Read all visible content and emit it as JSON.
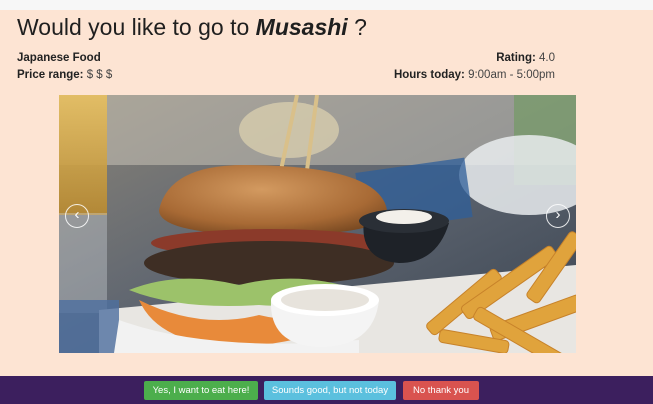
{
  "restaurant": {
    "question_prefix": "Would you like to go to",
    "name": "Musashi",
    "question_suffix": "?",
    "cuisine": "Japanese Food",
    "price_label": "Price range:",
    "price_value": "$ $ $",
    "rating_label": "Rating:",
    "rating_value": "4.0",
    "hours_label": "Hours today:",
    "hours_value": "9:00am - 5:00pm"
  },
  "carousel": {
    "prev_icon": "chevron-left-icon",
    "next_icon": "chevron-right-icon",
    "prev_glyph": "‹",
    "next_glyph": "›"
  },
  "actions": {
    "yes_label": "Yes, I want to eat here!",
    "maybe_label": "Sounds good, but not today",
    "no_label": "No thank you"
  },
  "colors": {
    "background": "#fde4d3",
    "footer": "#3c1f5e",
    "yes": "#4cae4c",
    "maybe": "#5bc0de",
    "no": "#d9534f"
  }
}
